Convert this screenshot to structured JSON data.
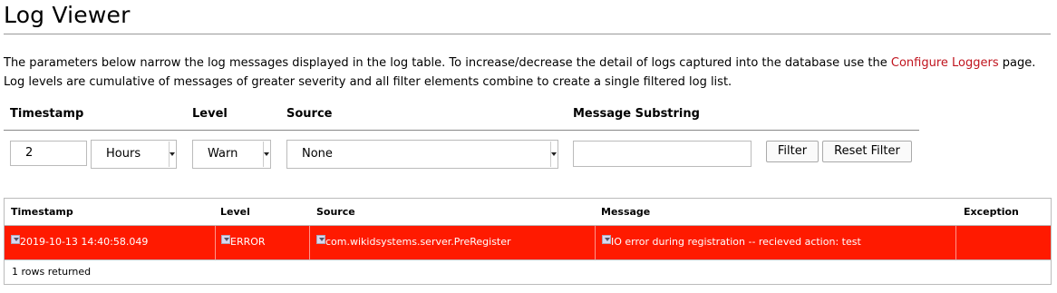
{
  "page": {
    "title": "Log Viewer"
  },
  "description": {
    "before": "The parameters below narrow the log messages displayed in the log table. To increase/decrease the detail of logs captured into the database use the ",
    "link": "Configure Loggers",
    "after": " page. Log levels are cumulative of messages of greater severity and all filter elements combine to create a single filtered log list."
  },
  "filters": {
    "timestamp_label": "Timestamp",
    "level_label": "Level",
    "source_label": "Source",
    "message_label": "Message Substring",
    "timestamp_value": "2",
    "timestamp_unit": "Hours",
    "level_value": "Warn",
    "source_value": "None",
    "message_value": "",
    "filter_button": "Filter",
    "reset_button": "Reset Filter"
  },
  "table": {
    "headers": [
      "Timestamp",
      "Level",
      "Source",
      "Message",
      "Exception"
    ],
    "rows": [
      {
        "timestamp": "2019-10-13 14:40:58.049",
        "level": "ERROR",
        "source": "com.wikidsystems.server.PreRegister",
        "message": "IO error during registration -- recieved action: test",
        "exception": "",
        "row_color": "#ff1a00"
      }
    ],
    "footer": "1 rows returned"
  },
  "icons": {
    "filter_cell_icon": "filter-icon"
  }
}
